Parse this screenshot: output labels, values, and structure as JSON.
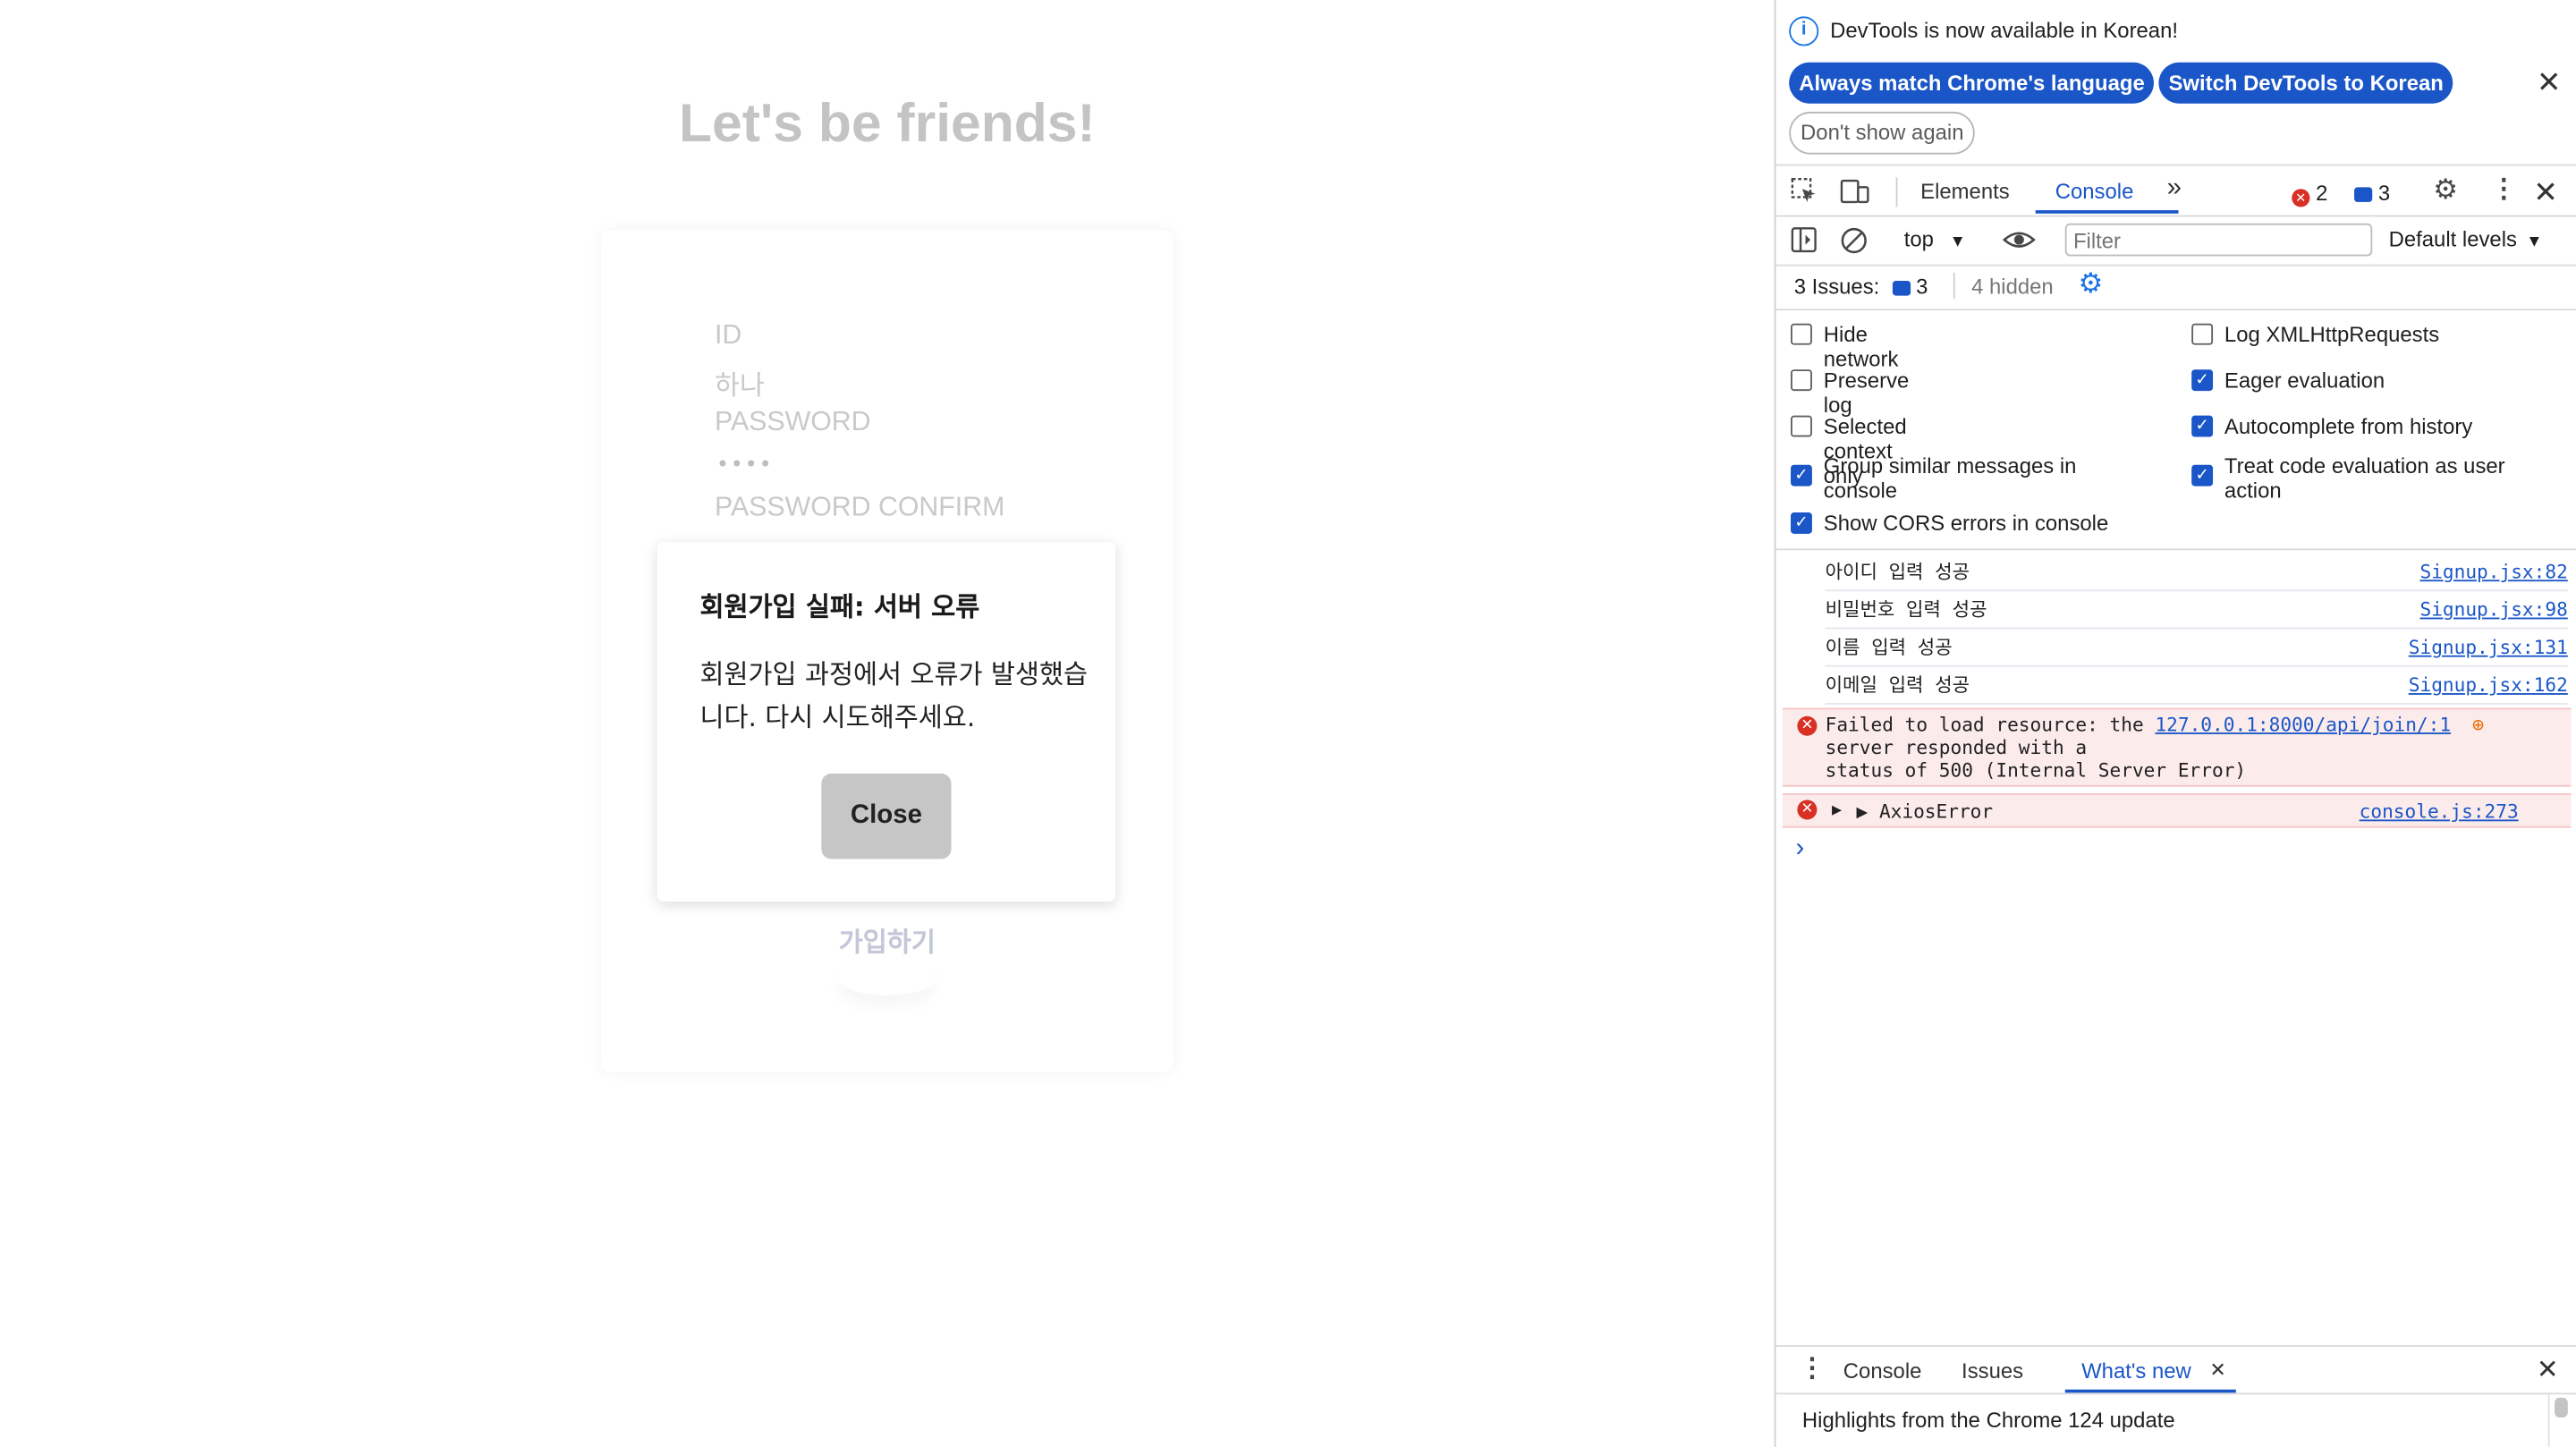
{
  "page": {
    "heading": "Let's be friends!",
    "fields": {
      "id_label": "ID",
      "id_value": "하나",
      "password_label": "PASSWORD",
      "password_value": "••••",
      "password_confirm_label": "PASSWORD CONFIRM"
    },
    "submit_label": "가입하기",
    "modal": {
      "title": "회원가입 실패: 서버 오류",
      "body": "회원가입 과정에서 오류가 발생했습니다. 다시 시도해주세요.",
      "close_label": "Close"
    }
  },
  "devtools": {
    "infobar": {
      "message": "DevTools is now available in Korean!",
      "always_match": "Always match Chrome's language",
      "switch_korean": "Switch DevTools to Korean",
      "dont_show": "Don't show again"
    },
    "tabs": {
      "elements": "Elements",
      "console": "Console",
      "more": "»"
    },
    "badges": {
      "errors": "2",
      "messages": "3"
    },
    "console_toolbar": {
      "context": "top",
      "filter_placeholder": "Filter",
      "levels": "Default levels"
    },
    "issues": {
      "label": "3 Issues:",
      "count": "3",
      "hidden": "4 hidden"
    },
    "settings": {
      "left": [
        {
          "label": "Hide network",
          "checked": false
        },
        {
          "label": "Preserve log",
          "checked": false
        },
        {
          "label": "Selected context only",
          "checked": false
        },
        {
          "label": "Group similar messages in console",
          "checked": true
        },
        {
          "label": "Show CORS errors in console",
          "checked": true
        }
      ],
      "right": [
        {
          "label": "Log XMLHttpRequests",
          "checked": false
        },
        {
          "label": "Eager evaluation",
          "checked": true
        },
        {
          "label": "Autocomplete from history",
          "checked": true
        },
        {
          "label": "Treat code evaluation as user action",
          "checked": true
        }
      ]
    },
    "logs": [
      {
        "text": "아이디 입력 성공",
        "source": "Signup.jsx:82"
      },
      {
        "text": "비밀번호 입력 성공",
        "source": "Signup.jsx:98"
      },
      {
        "text": "이름 입력 성공",
        "source": "Signup.jsx:131"
      },
      {
        "text": "이메일 입력 성공",
        "source": "Signup.jsx:162"
      }
    ],
    "error1": {
      "prefix": "Failed to load resource: the",
      "url": "127.0.0.1:8000/api/join/:1",
      "line2": "server responded with a",
      "line3": "status of 500 (Internal Server Error)"
    },
    "error2": {
      "text": "▶ AxiosError",
      "source": "console.js:273"
    },
    "prompt": "›",
    "drawer": {
      "console": "Console",
      "issues": "Issues",
      "whats_new": "What's new",
      "highlight": "Highlights from the Chrome 124 update"
    }
  }
}
